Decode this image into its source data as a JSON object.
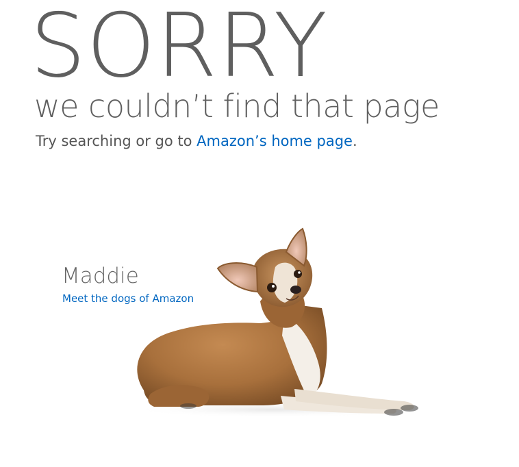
{
  "headline": "SORRY",
  "subheadline": "we couldn’t find that page",
  "message": {
    "prefix": "Try searching or go to ",
    "link_text": "Amazon’s home page",
    "suffix": "."
  },
  "dog": {
    "name": "Maddie",
    "link_text": "Meet the dogs of Amazon",
    "image_label": "chihuahua-photo"
  },
  "colors": {
    "text_gray": "#5f5f5f",
    "link_blue": "#0066c0",
    "background": "#ffffff"
  }
}
